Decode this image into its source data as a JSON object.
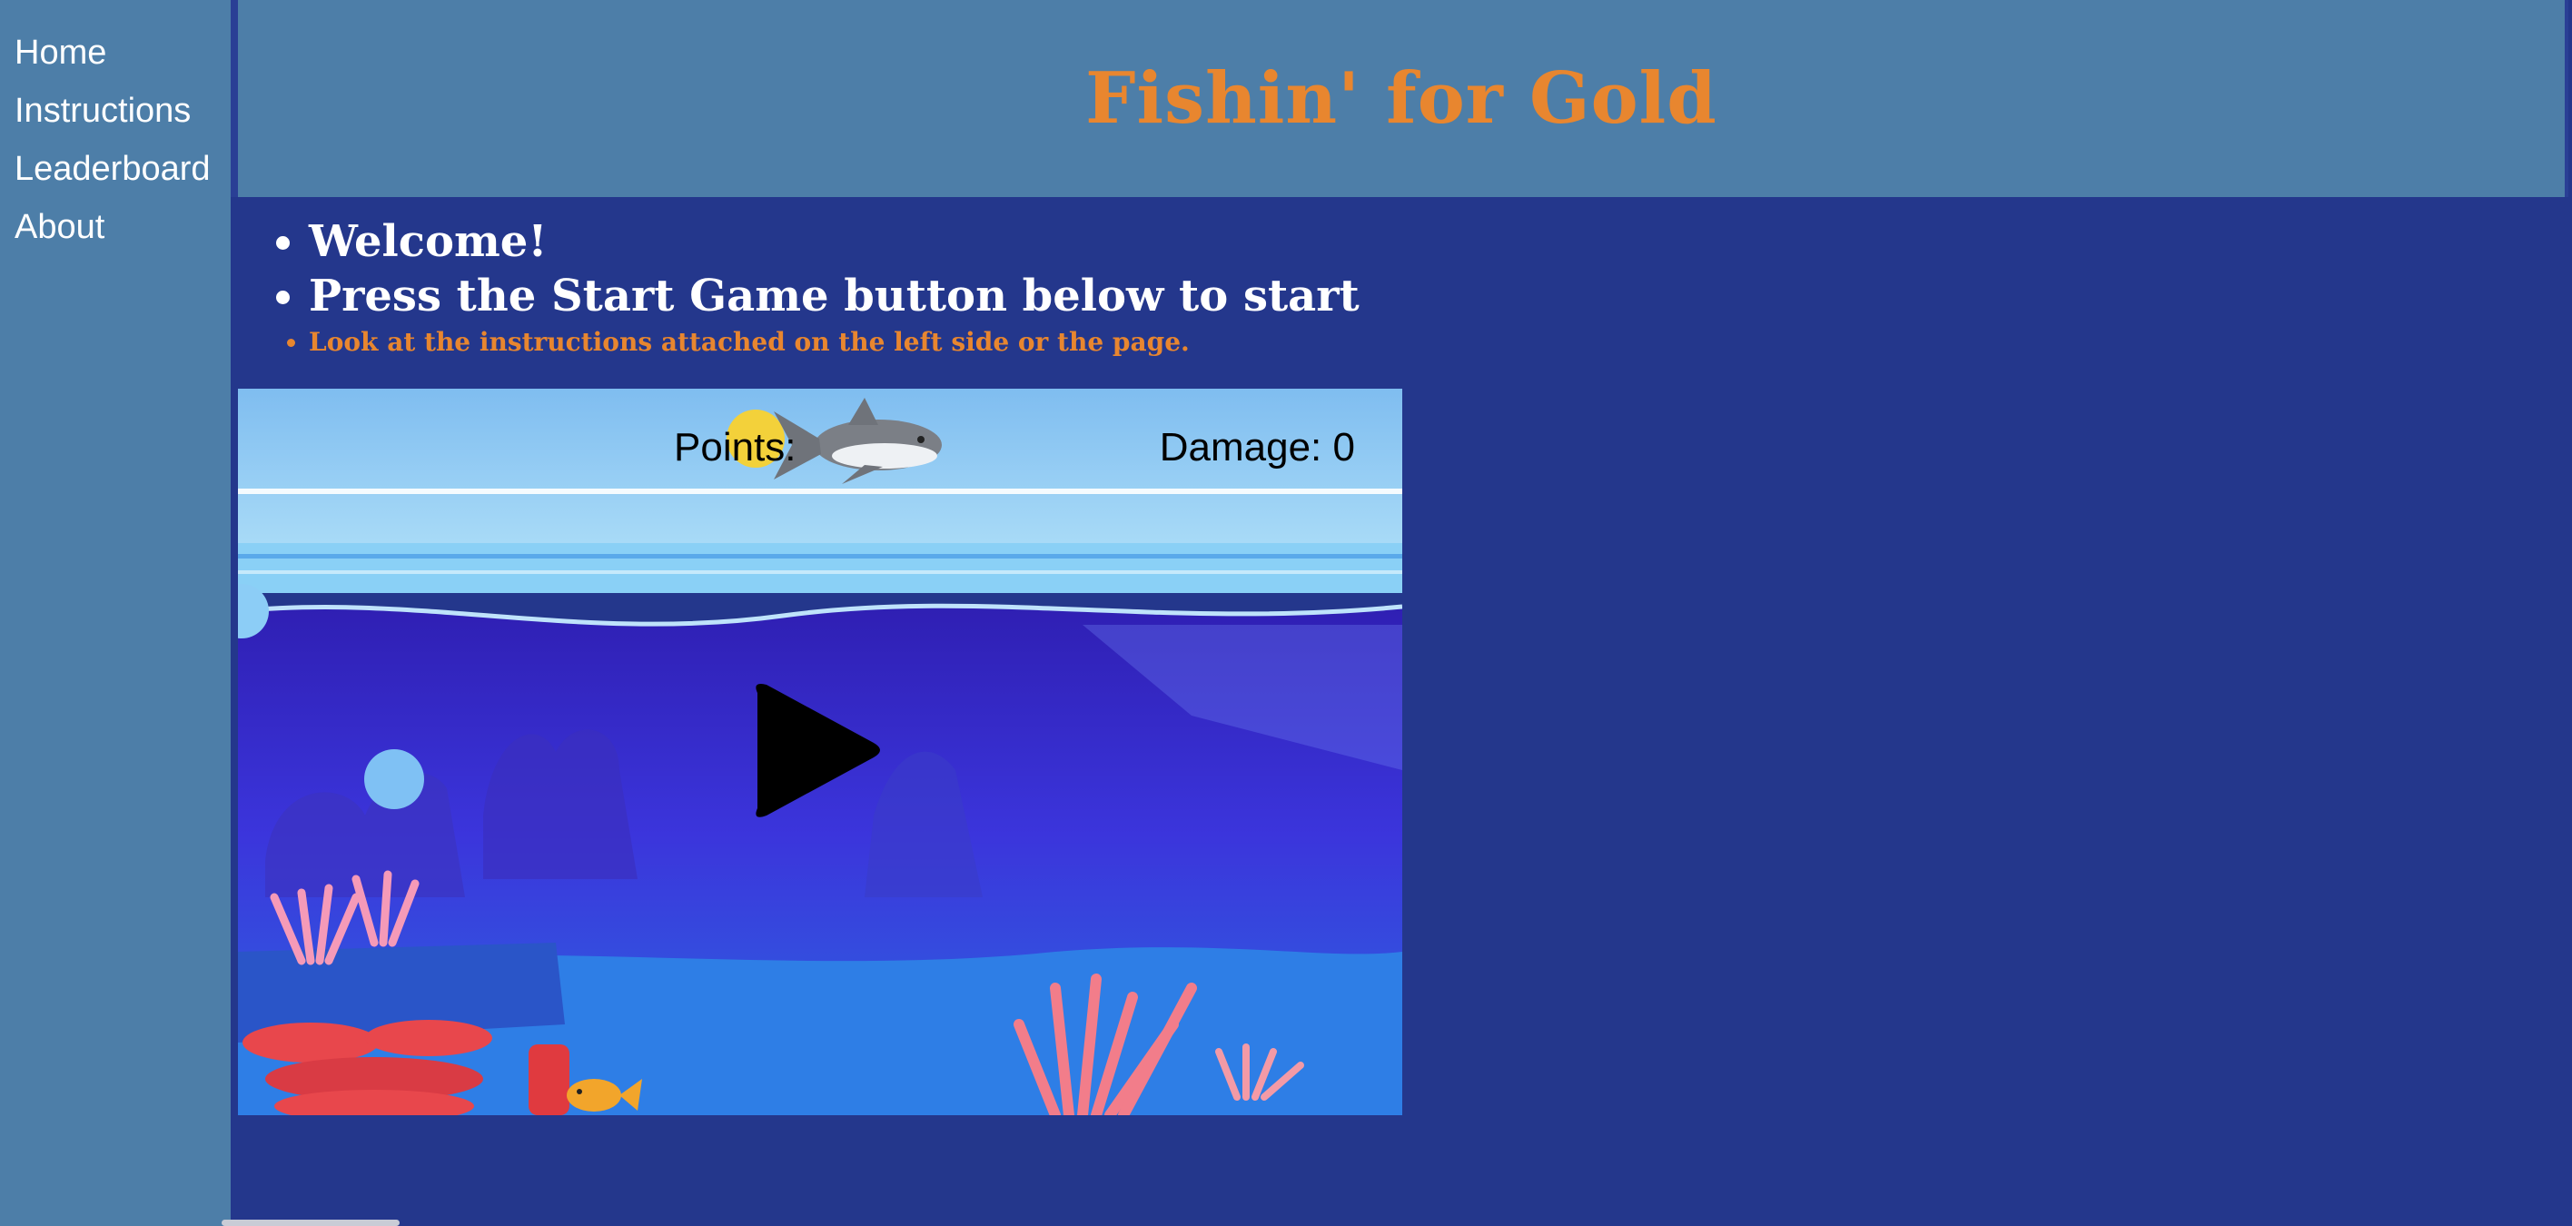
{
  "nav": {
    "items": [
      {
        "label": "Home"
      },
      {
        "label": "Instructions"
      },
      {
        "label": "Leaderboard"
      },
      {
        "label": "About"
      }
    ]
  },
  "header": {
    "title": "Fishin' for Gold"
  },
  "intro": {
    "line1": "Welcome!",
    "line2": "Press the Start Game button below to start",
    "line3": "Look at the instructions attached on the left side or the page."
  },
  "game": {
    "points_label": "Points:",
    "damage_label": "Damage:",
    "damage_value": "0",
    "colors": {
      "sky": "#8ec5ef",
      "water": "#3a2bd6",
      "accent": "#e8862f"
    }
  }
}
